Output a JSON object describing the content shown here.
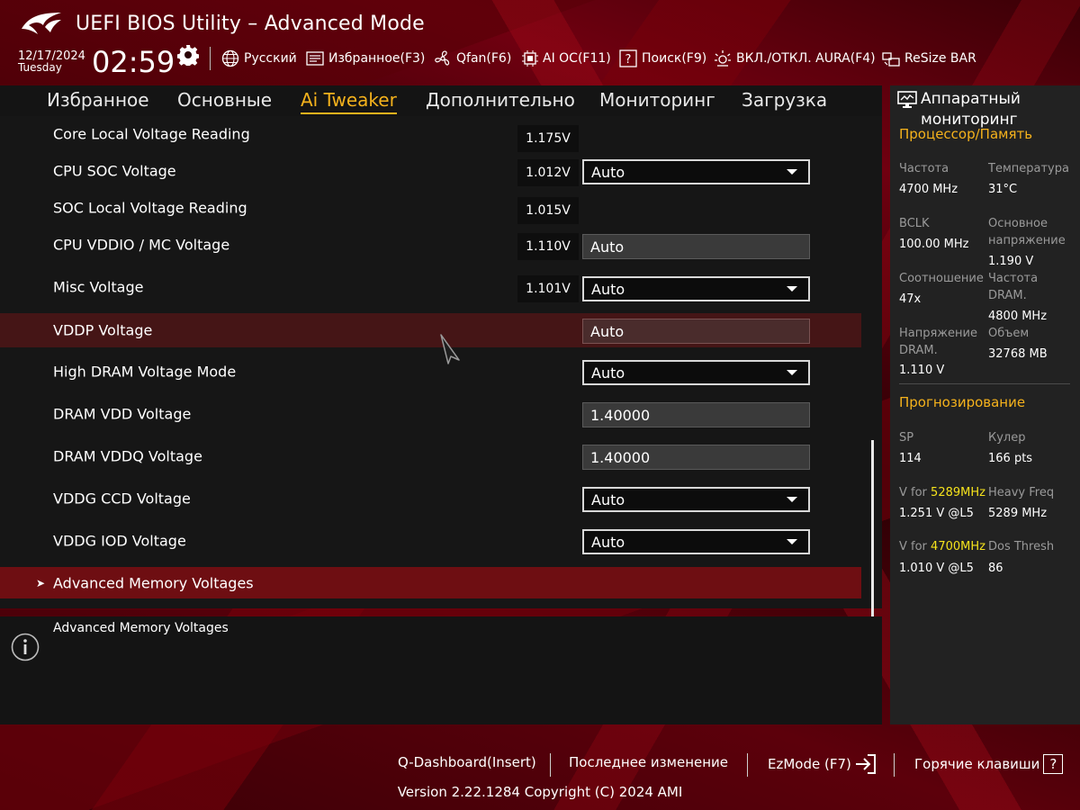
{
  "header": {
    "title": "UEFI BIOS Utility – Advanced Mode",
    "date": "12/17/2024",
    "weekday": "Tuesday",
    "time": "02:59",
    "toolbar": [
      {
        "label": "Русский",
        "icon": "globe-icon"
      },
      {
        "label": "Избранное(F3)",
        "icon": "favorites-icon"
      },
      {
        "label": "Qfan(F6)",
        "icon": "fan-icon"
      },
      {
        "label": "AI OC(F11)",
        "icon": "ai-chip-icon"
      },
      {
        "label": "Поиск(F9)",
        "icon": "search-help-icon"
      },
      {
        "label": "ВКЛ./ОТКЛ. AURA(F4)",
        "icon": "aura-icon"
      },
      {
        "label": "ReSize BAR",
        "icon": "resize-bar-icon"
      }
    ]
  },
  "tabs": [
    {
      "label": "Избранное",
      "active": false
    },
    {
      "label": "Основные",
      "active": false
    },
    {
      "label": "Ai Tweaker",
      "active": true
    },
    {
      "label": "Дополнительно",
      "active": false
    },
    {
      "label": "Мониторинг",
      "active": false
    },
    {
      "label": "Загрузка",
      "active": false
    }
  ],
  "settings": [
    {
      "label": "Core Local Voltage Reading",
      "reading": "1.175V",
      "control": null
    },
    {
      "label": "CPU SOC Voltage",
      "reading": "1.012V",
      "control": {
        "type": "select",
        "value": "Auto"
      }
    },
    {
      "label": "SOC Local Voltage Reading",
      "reading": "1.015V",
      "control": null
    },
    {
      "label": "CPU VDDIO / MC Voltage",
      "reading": "1.110V",
      "control": {
        "type": "field",
        "value": "Auto"
      }
    },
    {
      "label": "Misc Voltage",
      "reading": "1.101V",
      "control": {
        "type": "select",
        "value": "Auto"
      }
    },
    {
      "label": "VDDP Voltage",
      "reading": null,
      "control": {
        "type": "field",
        "value": "Auto"
      },
      "highlighted": true
    },
    {
      "label": "High DRAM Voltage Mode",
      "reading": null,
      "control": {
        "type": "select",
        "value": "Auto"
      }
    },
    {
      "label": "DRAM VDD Voltage",
      "reading": null,
      "control": {
        "type": "field",
        "value": "1.40000"
      }
    },
    {
      "label": "DRAM VDDQ Voltage",
      "reading": null,
      "control": {
        "type": "field",
        "value": "1.40000"
      }
    },
    {
      "label": "VDDG CCD Voltage",
      "reading": null,
      "control": {
        "type": "select",
        "value": "Auto"
      }
    },
    {
      "label": "VDDG IOD Voltage",
      "reading": null,
      "control": {
        "type": "select",
        "value": "Auto"
      }
    }
  ],
  "submenu": {
    "label": "Advanced Memory Voltages",
    "arrow": "➤"
  },
  "help": {
    "text": "Advanced Memory Voltages"
  },
  "monitor": {
    "title": "Аппаратный мониторинг",
    "cpu_section": "Процессор/Память",
    "cpu_stats": [
      {
        "label": "Частота",
        "value": "4700 MHz"
      },
      {
        "label": "Температура",
        "value": "31°C"
      },
      {
        "label": "BCLK",
        "value": "100.00 MHz"
      },
      {
        "label": "Основное напряжение",
        "value": "1.190 V"
      },
      {
        "label": "Соотношение",
        "value": "47x"
      },
      {
        "label": "Частота DRAM.",
        "value": "4800 MHz"
      },
      {
        "label": "Напряжение DRAM.",
        "value": "1.110 V"
      },
      {
        "label": "Объем",
        "value": "32768 MB"
      }
    ],
    "forecast_section": "Прогнозирование",
    "forecast_stats": [
      {
        "label": "SP",
        "value": "114"
      },
      {
        "label": "Кулер",
        "value": "166 pts"
      },
      {
        "label_prefix": "V for ",
        "label_freq": "5289MHz",
        "value": "1.251 V @L5"
      },
      {
        "label": "Heavy Freq",
        "value": "5289 MHz"
      },
      {
        "label_prefix": "V for ",
        "label_freq": "4700MHz",
        "value": "1.010 V @L5"
      },
      {
        "label": "Dos Thresh",
        "value": "86"
      }
    ]
  },
  "footer": {
    "qdashboard": "Q-Dashboard(Insert)",
    "last_change": "Последнее изменение",
    "ezmode": "EzMode (F7)",
    "hotkeys": "Горячие клавиши",
    "hotkeys_glyph": "?",
    "version": "Version 2.22.1284 Copyright (C) 2024 AMI"
  },
  "colors": {
    "accent": "#f5b21c",
    "highlight_row": "#6e1618",
    "submenu_row": "#6e0e12"
  }
}
